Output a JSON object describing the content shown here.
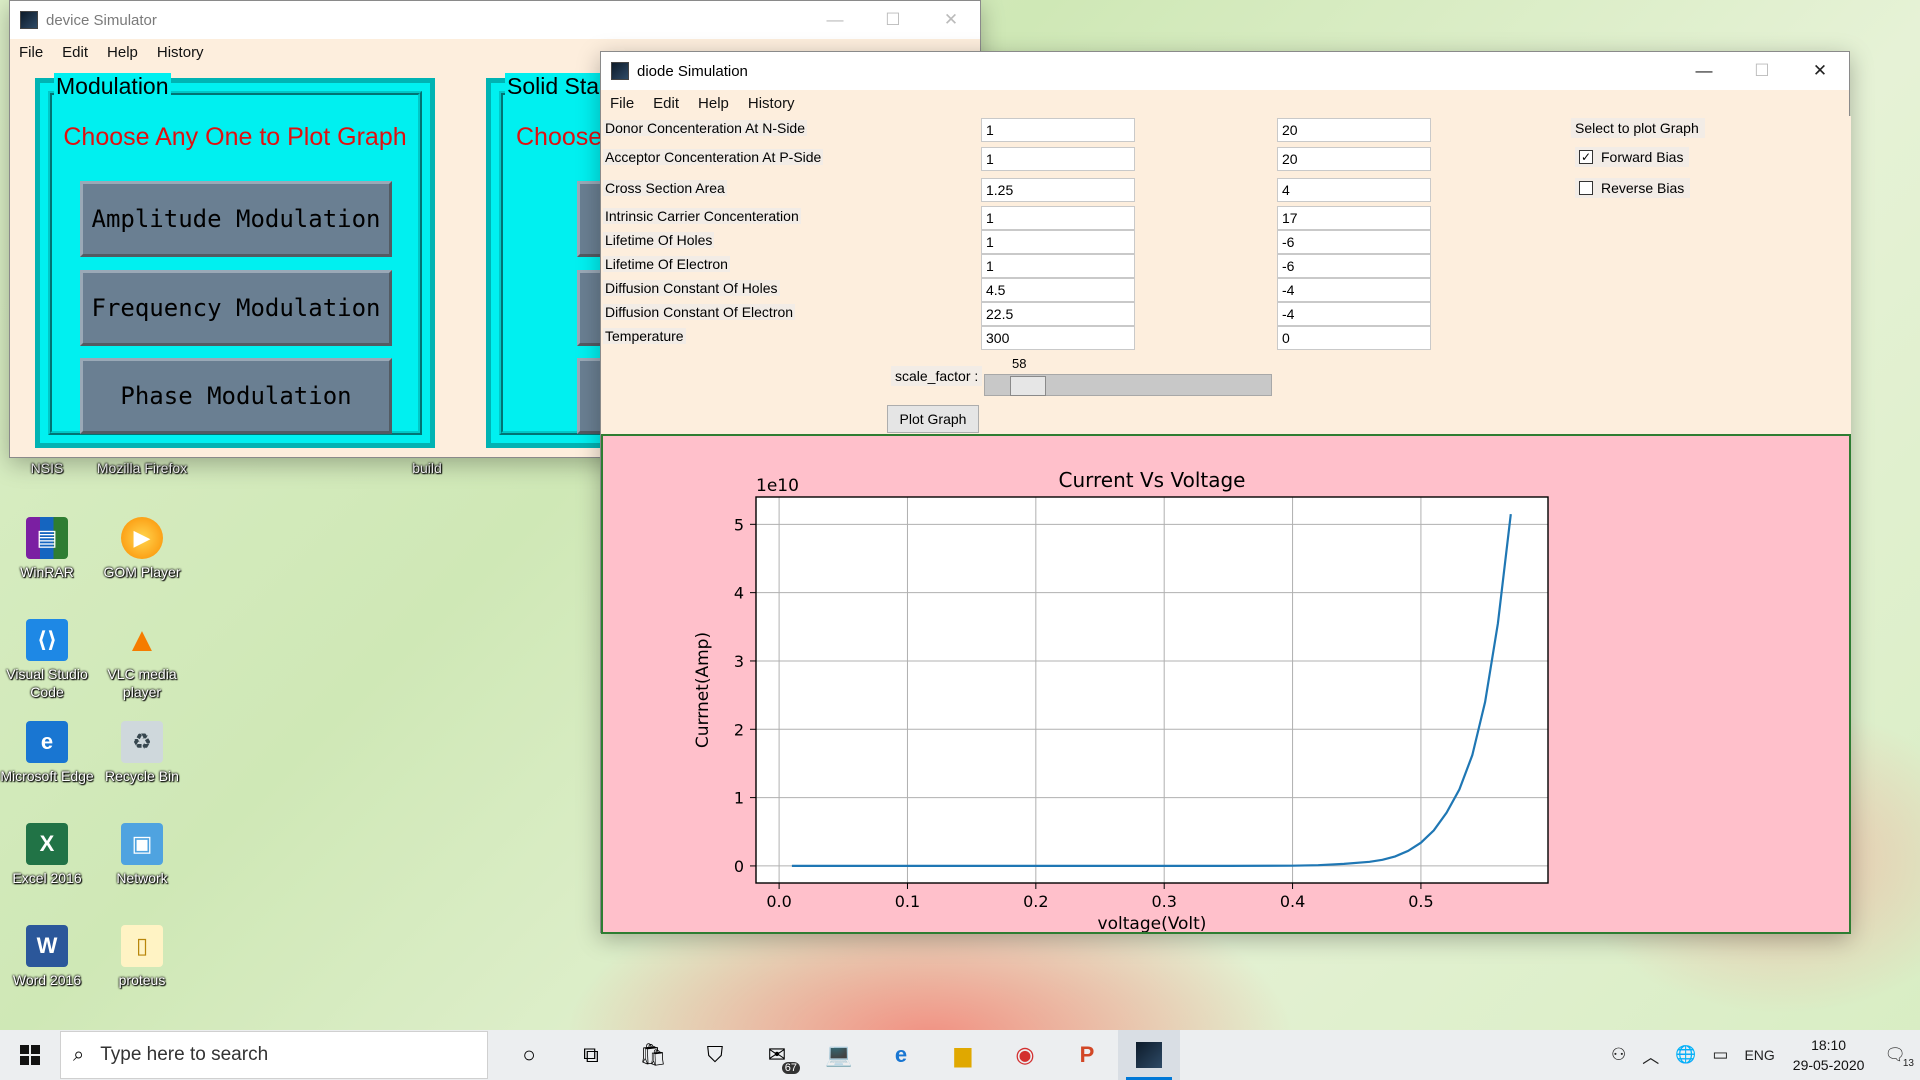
{
  "desktop": {
    "icons": [
      {
        "label": "NSIS",
        "icon": "nsis-icon"
      },
      {
        "label": "Mozilla Firefox",
        "icon": "firefox-icon"
      },
      {
        "label": "build",
        "icon": "folder-icon"
      },
      {
        "label": "WinRAR",
        "icon": "winrar-icon"
      },
      {
        "label": "GOM Player",
        "icon": "gom-player-icon"
      },
      {
        "label": "Visual Studio Code",
        "icon": "vscode-icon"
      },
      {
        "label": "VLC media player",
        "icon": "vlc-icon"
      },
      {
        "label": "Microsoft Edge",
        "icon": "edge-icon"
      },
      {
        "label": "Recycle Bin",
        "icon": "recycle-bin-icon"
      },
      {
        "label": "Excel 2016",
        "icon": "excel-icon"
      },
      {
        "label": "Network",
        "icon": "network-icon"
      },
      {
        "label": "Word 2016",
        "icon": "word-icon"
      },
      {
        "label": "proteus",
        "icon": "folder-icon"
      }
    ]
  },
  "device_window": {
    "title": "device Simulator",
    "menu": [
      "File",
      "Edit",
      "Help",
      "History"
    ],
    "modulation_panel": {
      "title": "Modulation",
      "subtitle": "Choose Any One to Plot Graph",
      "buttons": [
        "Amplitude Modulation",
        "Frequency Modulation",
        "Phase Modulation"
      ]
    },
    "solid_state_panel": {
      "title": "Solid Sta",
      "subtitle": "Choose"
    }
  },
  "diode_window": {
    "title": "diode Simulation",
    "menu": [
      "File",
      "Edit",
      "Help",
      "History"
    ],
    "fields": [
      {
        "label": "Donor Concenteration At N-Side",
        "value": "1",
        "exponent": "20"
      },
      {
        "label": "Acceptor Concenteration At P-Side",
        "value": "1",
        "exponent": "20"
      },
      {
        "label": "Cross Section Area",
        "value": "1.25",
        "exponent": "4"
      },
      {
        "label": "Intrinsic Carrier Concenteration",
        "value": "1",
        "exponent": "17"
      },
      {
        "label": "Lifetime Of Holes",
        "value": "1",
        "exponent": "-6"
      },
      {
        "label": "Lifetime Of Electron",
        "value": "1",
        "exponent": "-6"
      },
      {
        "label": "Diffusion Constant Of Holes",
        "value": "4.5",
        "exponent": "-4"
      },
      {
        "label": "Diffusion Constant Of Electron",
        "value": "22.5",
        "exponent": "-4"
      },
      {
        "label": "Temperature",
        "value": "300",
        "exponent": "0"
      }
    ],
    "plot_select": {
      "heading": "Select to plot Graph",
      "forward_bias": {
        "label": "Forward Bias",
        "checked": true
      },
      "reverse_bias": {
        "label": "Reverse Bias",
        "checked": false
      }
    },
    "slider": {
      "label": "scale_factor :",
      "value": "58",
      "fraction": 0.1
    },
    "plot_button": "Plot Graph"
  },
  "chart_data": {
    "type": "line",
    "title": "Current Vs Voltage",
    "xlabel": "voltage(Volt)",
    "ylabel": "Currnet(Amp)",
    "y_offset_text": "1e10",
    "xlim": [
      -0.018,
      0.599
    ],
    "ylim": [
      -0.25,
      5.4
    ],
    "x_ticks": [
      0.0,
      0.1,
      0.2,
      0.3,
      0.4,
      0.5
    ],
    "x_tick_labels": [
      "0.0",
      "0.1",
      "0.2",
      "0.3",
      "0.4",
      "0.5"
    ],
    "y_ticks": [
      0,
      1,
      2,
      3,
      4,
      5
    ],
    "y_tick_labels": [
      "0",
      "1",
      "2",
      "3",
      "4",
      "5"
    ],
    "grid": true,
    "color": "#1f77b4",
    "series": [
      {
        "x": [
          0.01,
          0.1,
          0.2,
          0.3,
          0.35,
          0.4,
          0.42,
          0.44,
          0.46,
          0.47,
          0.48,
          0.49,
          0.5,
          0.51,
          0.52,
          0.53,
          0.54,
          0.55,
          0.56,
          0.57
        ],
        "y": [
          0.0,
          0.0,
          0.0,
          0.0,
          0.0,
          0.003,
          0.01,
          0.03,
          0.06,
          0.09,
          0.14,
          0.22,
          0.34,
          0.52,
          0.78,
          1.12,
          1.62,
          2.4,
          3.55,
          5.15
        ]
      }
    ]
  },
  "taskbar": {
    "search_placeholder": "Type here to search",
    "mail_badge": "67",
    "apps": [
      "cortana-icon",
      "task-view-icon",
      "store-icon",
      "shield-icon",
      "mail-icon",
      "laptop-icon",
      "edge-icon",
      "file-explorer-icon",
      "chrome-icon",
      "powerpoint-icon",
      "python-icon"
    ],
    "language": "ENG",
    "time": "18:10",
    "date": "29-05-2020",
    "notification_count": "13"
  }
}
